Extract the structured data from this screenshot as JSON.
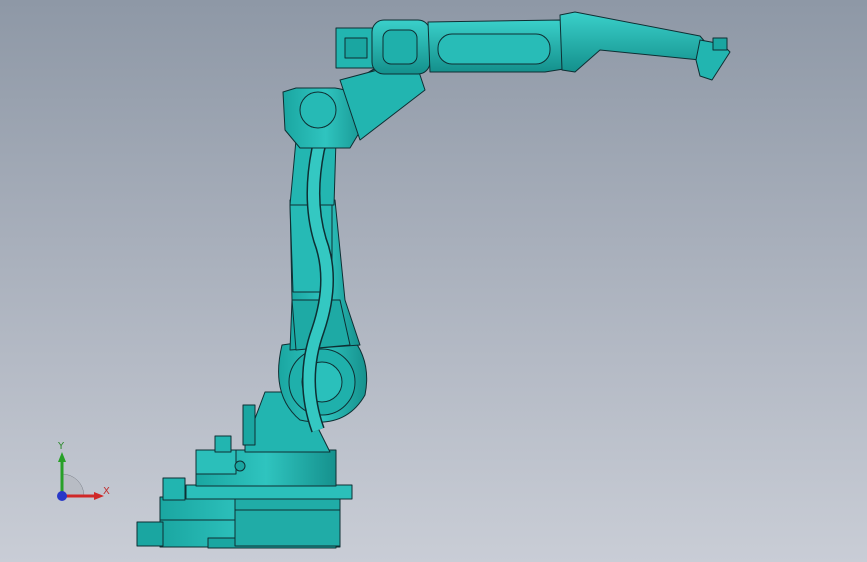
{
  "viewport": {
    "background_top": "#8e98a6",
    "background_bottom": "#c9cdd6",
    "model_name": "robot-arm-model",
    "model_color": "#22b5b0",
    "model_shade": "#14908c",
    "edge_color": "#0e2f33"
  },
  "triad": {
    "x_label": "X",
    "y_label": "Y",
    "x_color": "#d02828",
    "y_color": "#28a028",
    "z_color": "#2838c8"
  }
}
